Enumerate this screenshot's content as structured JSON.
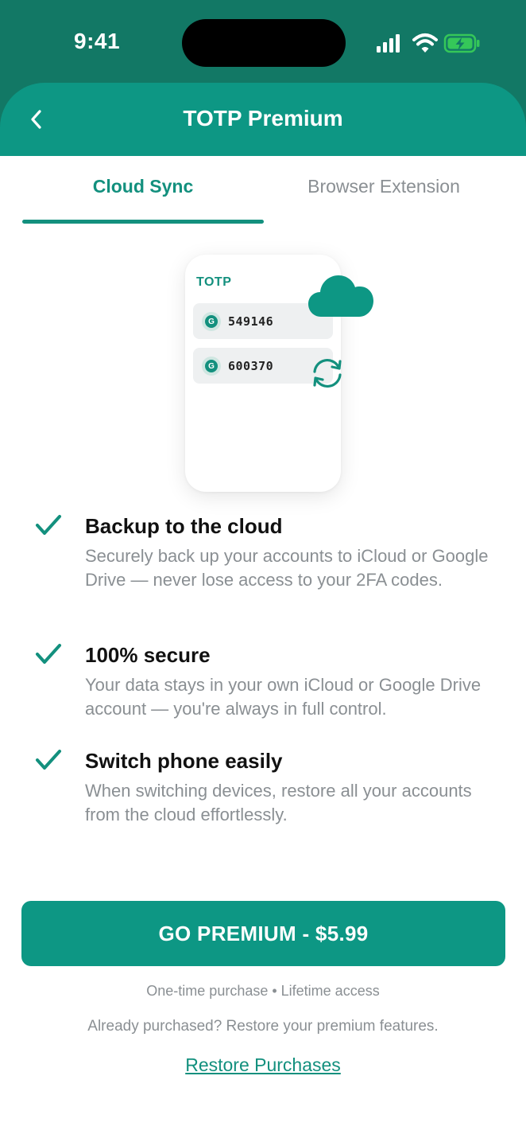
{
  "status_bar": {
    "time": "9:41"
  },
  "header": {
    "title": "TOTP Premium",
    "back_icon": "chevron-left-icon"
  },
  "tabs": [
    {
      "label": "Cloud Sync",
      "active": true
    },
    {
      "label": "Browser Extension",
      "active": false
    }
  ],
  "illustration": {
    "app_name": "TOTP",
    "codes": [
      {
        "badge": "G",
        "code": "549146"
      },
      {
        "badge": "G",
        "code": "600370"
      }
    ],
    "icons": [
      "cloud-icon",
      "sync-icon"
    ]
  },
  "features": [
    {
      "title": "Backup to the cloud",
      "description": "Securely back up your accounts to iCloud or Google Drive — never lose access to your 2FA codes."
    },
    {
      "title": "100% secure",
      "description": "Your data stays in your own iCloud or Google Drive account — you're always in full control."
    },
    {
      "title": "Switch phone easily",
      "description": "When switching devices, restore all your accounts from the cloud effortlessly."
    }
  ],
  "cta": {
    "label": "GO PREMIUM - $5.99",
    "subtitle": "One-time purchase • Lifetime access"
  },
  "restore": {
    "prompt": "Already purchased? Restore your premium features.",
    "link_label": "Restore Purchases"
  },
  "colors": {
    "header_dark": "#127865",
    "header_primary": "#0d9784",
    "accent": "#13907e",
    "muted_text": "#8a8f93",
    "battery": "#35c759"
  }
}
